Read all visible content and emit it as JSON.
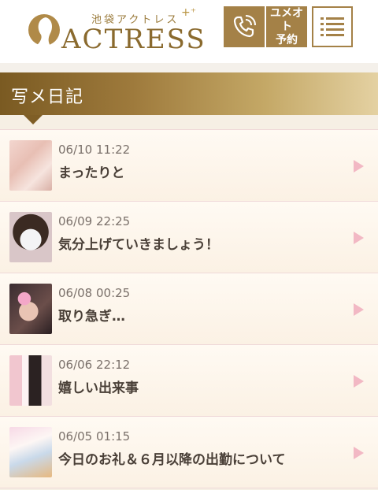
{
  "header": {
    "logo_sub": "池袋アクトレス",
    "logo_sparkle": "+⁺",
    "logo_main": "ACTRESS",
    "phone_button": "phone-icon",
    "reserve_label_line1": "ユメオト",
    "reserve_label_line2": "予約",
    "menu_button": "hamburger-menu-icon"
  },
  "section": {
    "title": "写メ日記"
  },
  "diary": [
    {
      "date": "06/10 11:22",
      "title": "まったりと"
    },
    {
      "date": "06/09 22:25",
      "title": "気分上げていきましょう！"
    },
    {
      "date": "06/08 00:25",
      "title": "取り急ぎ…"
    },
    {
      "date": "06/06 22:12",
      "title": "嬉しい出来事"
    },
    {
      "date": "06/05 01:15",
      "title": "今日のお礼＆６月以降の出勤について"
    }
  ],
  "colors": {
    "accent_gold": "#a48147",
    "arrow_pink": "#f2b8c4"
  }
}
